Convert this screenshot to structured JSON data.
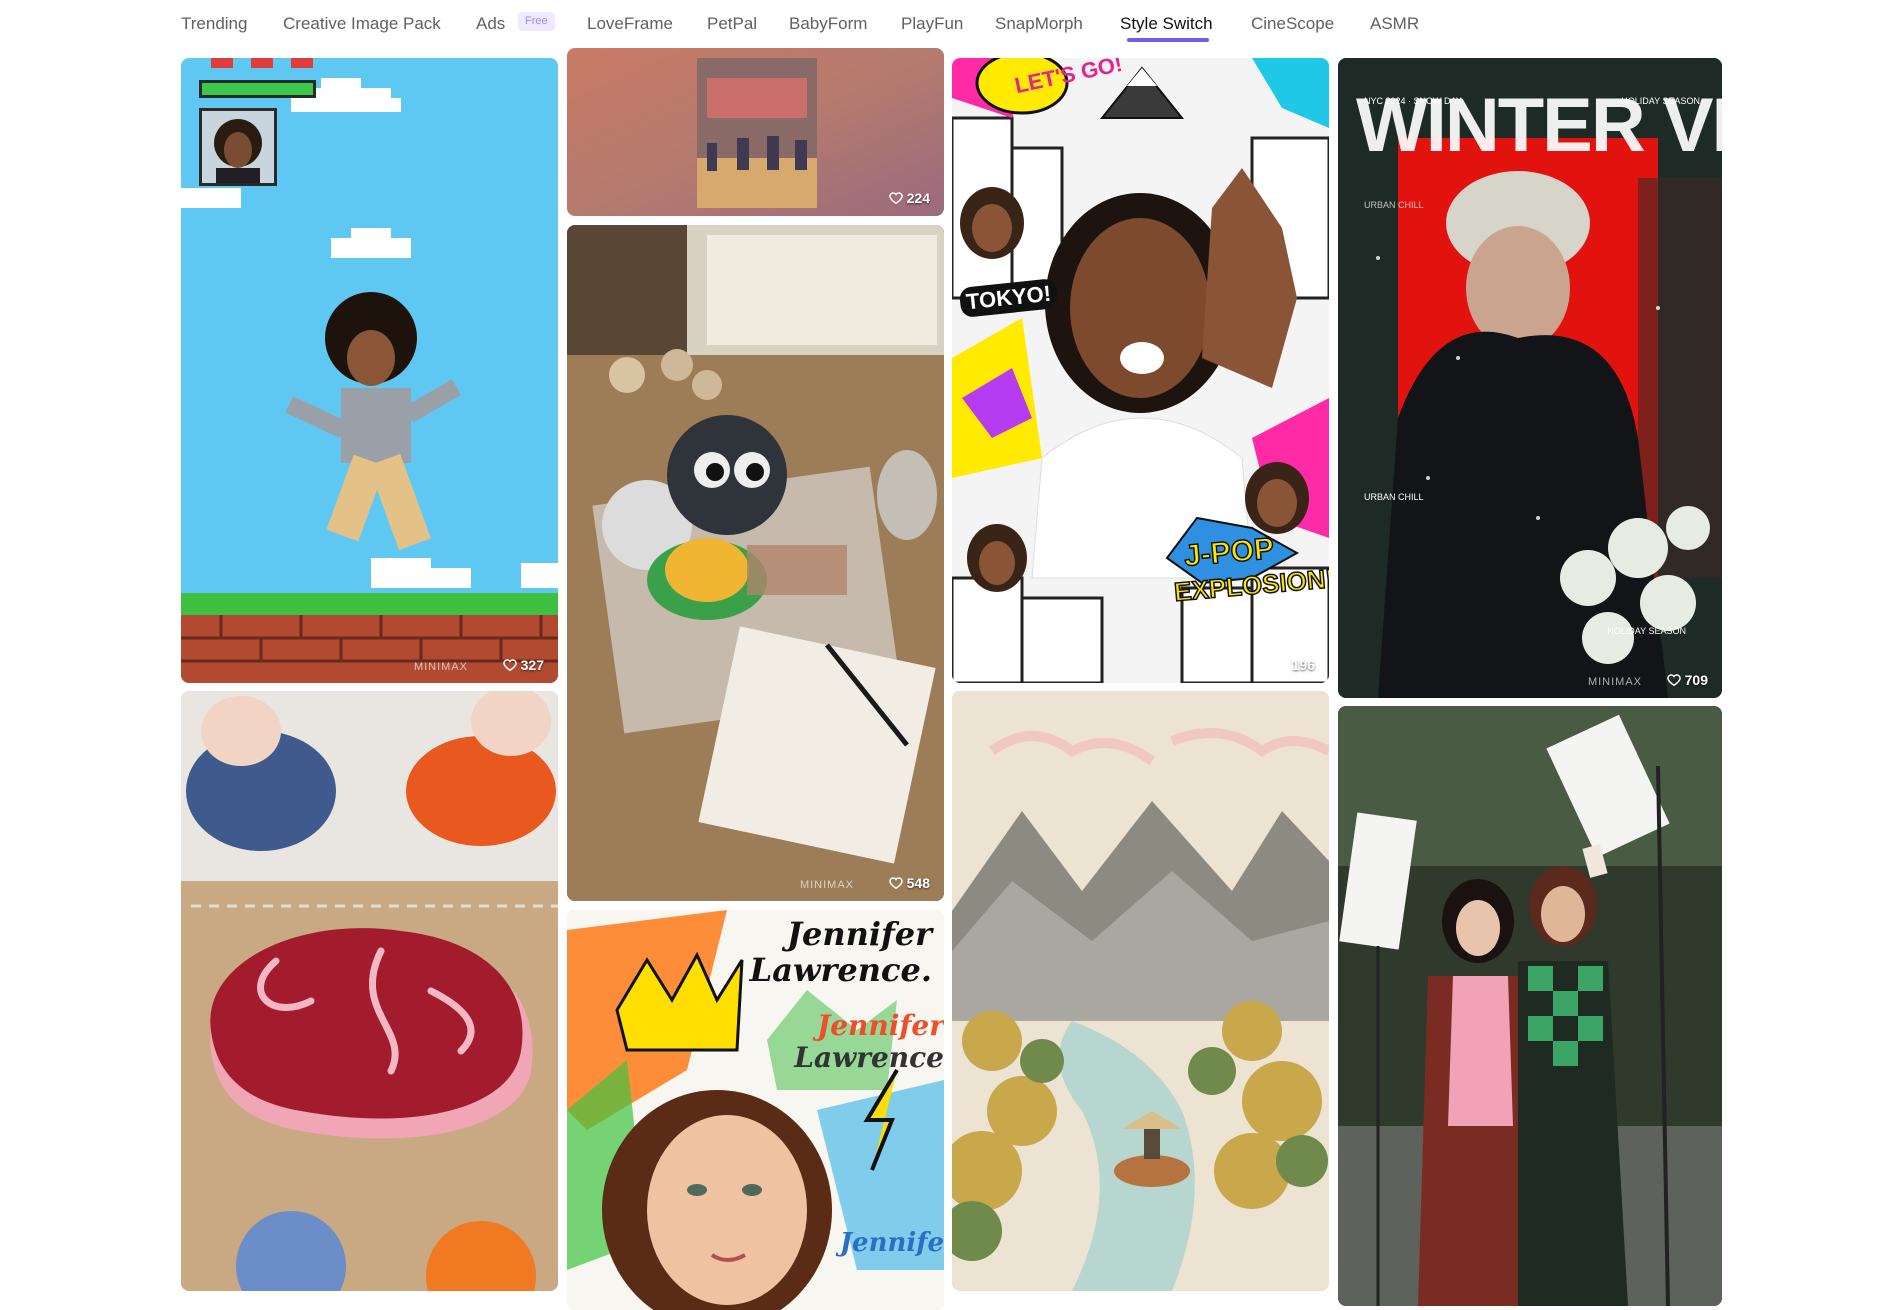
{
  "tabs": [
    {
      "label": "Trending",
      "active": false
    },
    {
      "label": "Creative Image Pack",
      "active": false
    },
    {
      "label": "Ads",
      "active": false,
      "badge": "Free"
    },
    {
      "label": "LoveFrame",
      "active": false
    },
    {
      "label": "PetPal",
      "active": false
    },
    {
      "label": "BabyForm",
      "active": false
    },
    {
      "label": "PlayFun",
      "active": false
    },
    {
      "label": "SnapMorph",
      "active": false
    },
    {
      "label": "Style Switch",
      "active": true
    },
    {
      "label": "CineScope",
      "active": false
    },
    {
      "label": "ASMR",
      "active": false
    }
  ],
  "accent_color": "#6e5ce6",
  "cards": {
    "pixel_game": {
      "likes": "327",
      "watermark": "MINIMAX",
      "icon": "heart-icon"
    },
    "village_blur": {
      "likes": "224",
      "icon": "heart-icon"
    },
    "perler_craft": {
      "likes": "548",
      "watermark": "MINIMAX",
      "icon": "heart-icon"
    },
    "tokyo_pop": {
      "likes": "196",
      "icon": "heart-icon",
      "texts": {
        "top": "LET'S GO!",
        "city": "TOKYO!",
        "title1": "J-POP",
        "title2": "EXPLOSION!"
      }
    },
    "winter_vibes": {
      "likes": "709",
      "watermark": "MINIMAX",
      "icon": "heart-icon",
      "texts": {
        "title": "WINTER VIBES",
        "tag_left": "NYC 2024 · SNOW DAY",
        "tag_right": "HOLIDAY SEASON",
        "sub1": "URBAN CHILL",
        "sub2": "URBAN CHILL",
        "sub3": "HOLIDAY SEASON"
      }
    },
    "felt_steak": {},
    "crayon_portrait": {
      "texts": {
        "name1": "Jennifer",
        "name2": "Lawrence.",
        "name3": "Jennifer",
        "name4": "Lawrence",
        "name5": "Jennife"
      }
    },
    "embroidered_river": {},
    "cosplay_selfie": {}
  }
}
